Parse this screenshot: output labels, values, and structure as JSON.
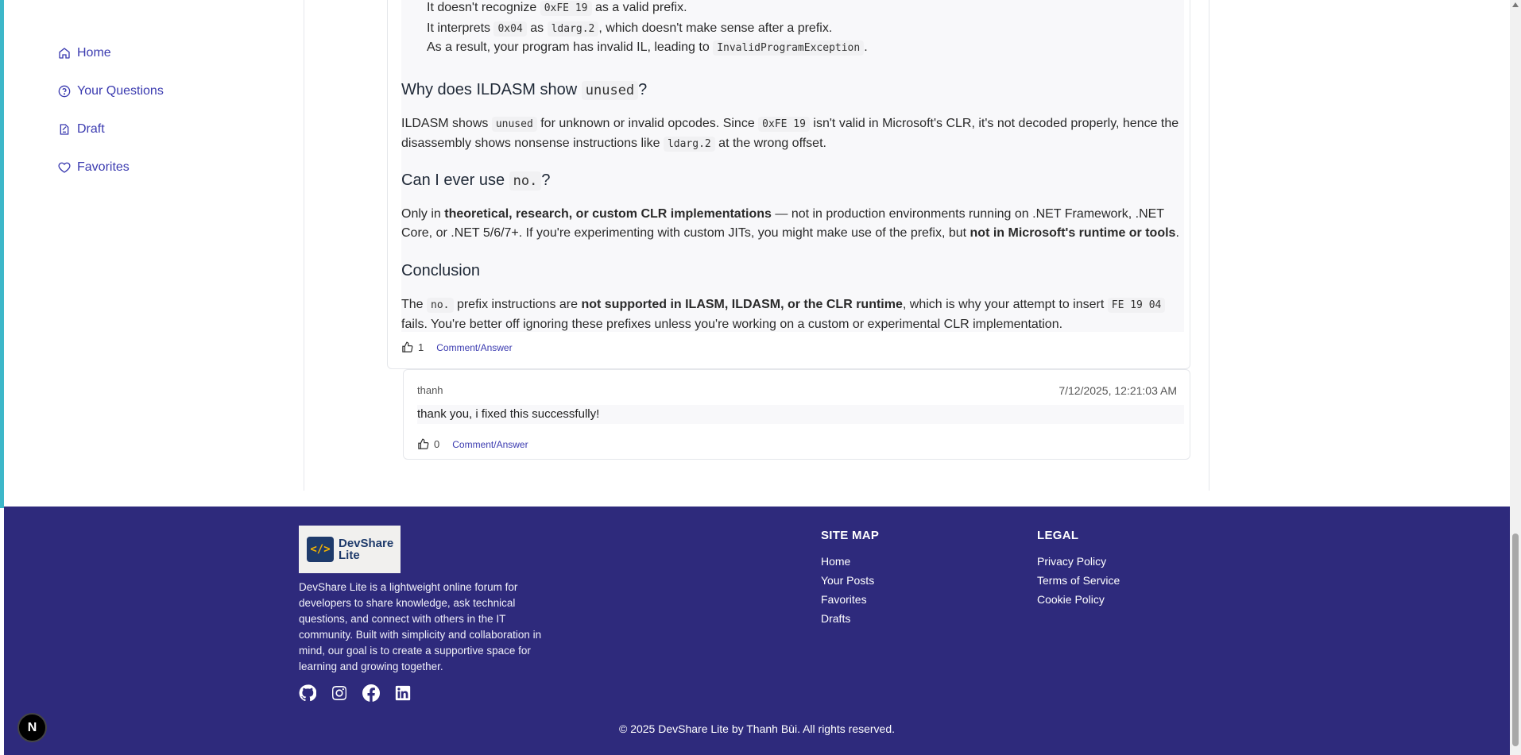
{
  "sidebar": {
    "items": [
      {
        "label": "Home",
        "icon": "home-icon"
      },
      {
        "label": "Your Questions",
        "icon": "question-circle-icon"
      },
      {
        "label": "Draft",
        "icon": "draft-icon"
      },
      {
        "label": "Favorites",
        "icon": "heart-icon"
      }
    ]
  },
  "answer": {
    "bullets": [
      {
        "a": "It doesn't recognize ",
        "code": "0xFE 19",
        "b": " as a valid prefix."
      },
      {
        "a": "It interprets ",
        "code1": "0x04",
        "mid": " as ",
        "code2": "ldarg.2",
        "b": ", which doesn't make sense after a prefix."
      },
      {
        "a": "As a result, your program has invalid IL, leading to ",
        "code": "InvalidProgramException",
        "b": "."
      }
    ],
    "h_unused": {
      "a": "Why does ILDASM show ",
      "code": "unused",
      "b": "?"
    },
    "p_unused": {
      "a": "ILDASM shows ",
      "code1": "unused",
      "b": " for unknown or invalid opcodes. Since ",
      "code2": "0xFE 19",
      "c": " isn't valid in Microsoft's CLR, it's not decoded properly, hence the disassembly shows nonsense instructions like ",
      "code3": "ldarg.2",
      "d": " at the wrong offset."
    },
    "h_use": {
      "a": "Can I ever use ",
      "code": "no.",
      "b": "?"
    },
    "p_use": {
      "a": "Only in ",
      "bold1": "theoretical, research, or custom CLR implementations",
      "b": " — not in production environments running on .NET Framework, .NET Core, or .NET 5/6/7+. If you're experimenting with custom JITs, you might make use of the prefix, but ",
      "bold2": "not in Microsoft's runtime or tools",
      "c": "."
    },
    "h_conclusion": "Conclusion",
    "p_conclusion": {
      "a": "The ",
      "code1": "no.",
      "b": " prefix instructions are ",
      "bold": "not supported in ILASM, ILDASM, or the CLR runtime",
      "c": ", which is why your attempt to insert ",
      "code2": "FE 19 04",
      "d": " fails. You're better off ignoring these prefixes unless you're working on a custom or experimental CLR implementation."
    },
    "likes": "1",
    "comment_label": "Comment/Answer"
  },
  "comment": {
    "author": "thanh",
    "timestamp": "7/12/2025, 12:21:03 AM",
    "body": "thank you, i fixed this successfully!",
    "likes": "0",
    "comment_label": "Comment/Answer"
  },
  "footer": {
    "logo_line1": "DevShare",
    "logo_line2": "Lite",
    "logo_glyph": "</>",
    "description": "DevShare Lite is a lightweight online forum for developers to share knowledge, ask technical questions, and connect with others in the IT community. Built with simplicity and collaboration in mind, our goal is to create a supportive space for learning and growing together.",
    "sitemap_title": "SITE MAP",
    "sitemap": [
      "Home",
      "Your Posts",
      "Favorites",
      "Drafts"
    ],
    "legal_title": "LEGAL",
    "legal": [
      "Privacy Policy",
      "Terms of Service",
      "Cookie Policy"
    ],
    "socials": [
      "github-icon",
      "instagram-icon",
      "facebook-icon",
      "linkedin-icon"
    ],
    "copyright": "© 2025 DevShare Lite by Thanh Bùi. All rights reserved.",
    "bg_color": "#2e2a7c"
  },
  "badge": "N"
}
